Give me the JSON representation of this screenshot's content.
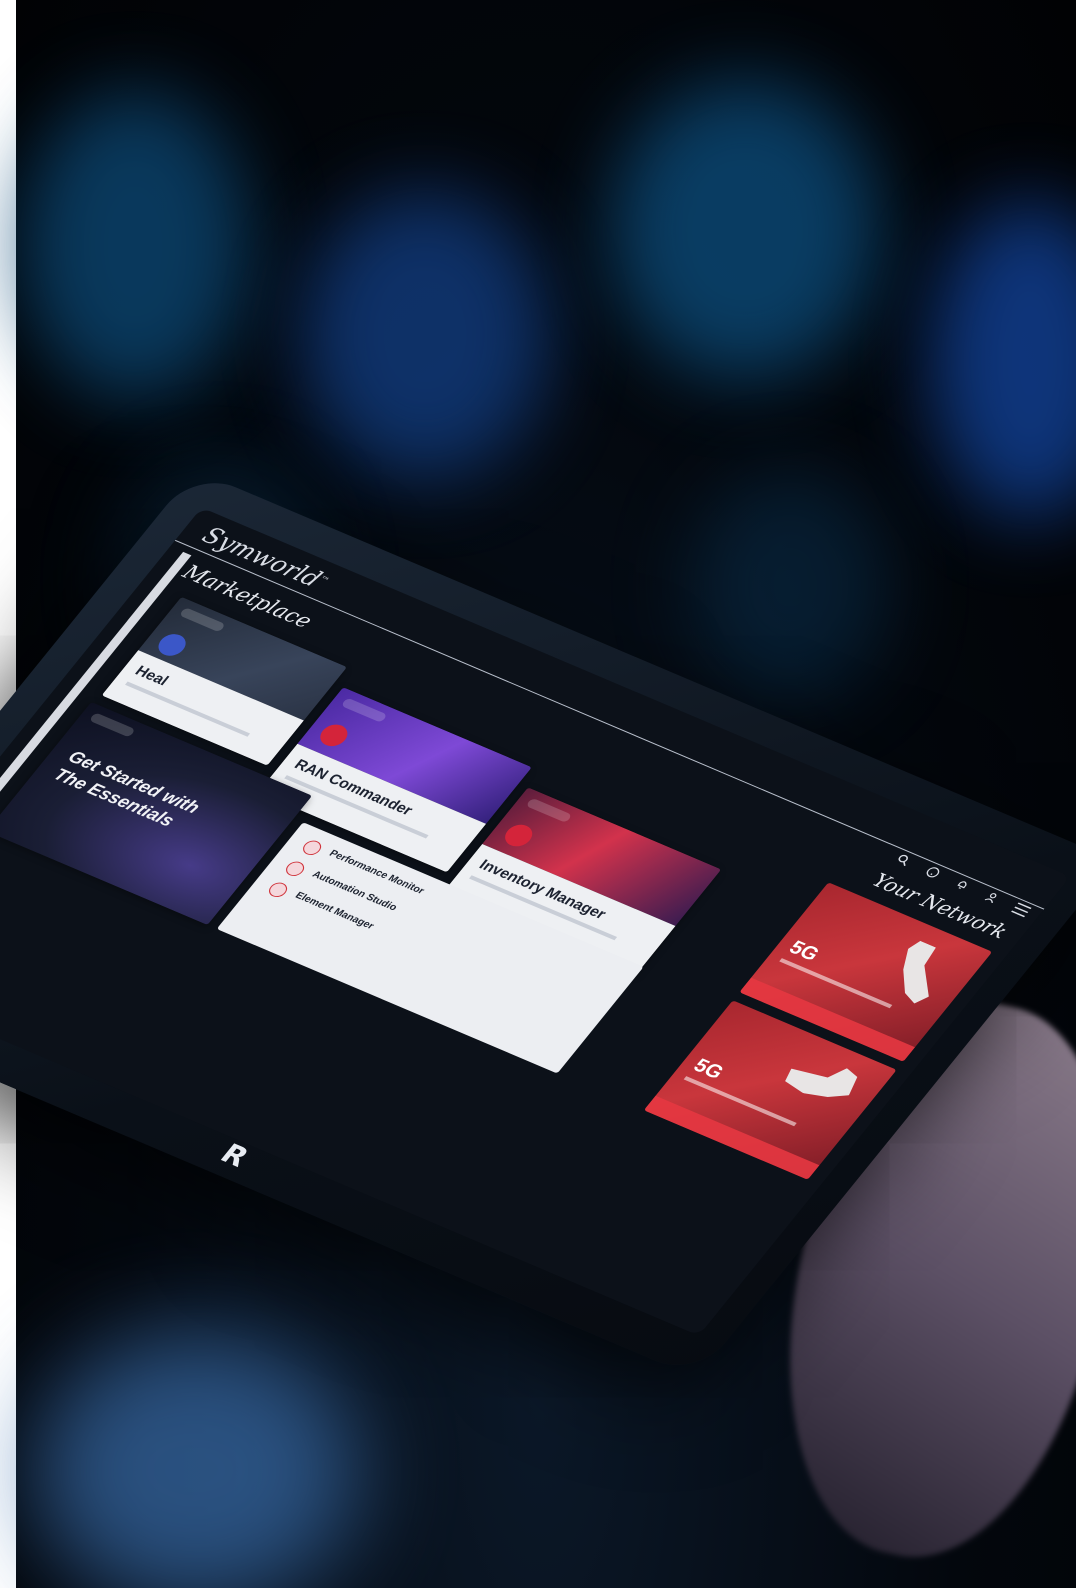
{
  "app": {
    "brand": "Symworld",
    "brand_mark": "™",
    "device_logo": "R"
  },
  "marketplace": {
    "title": "Marketplace",
    "cards": [
      {
        "title": "Heal"
      },
      {
        "title": "RAN Commander"
      },
      {
        "title": "Inventory Manager"
      }
    ],
    "essentials": {
      "title_line1": "Get Started with",
      "title_line2": "The Essentials"
    },
    "list_items": [
      {
        "name": "Performance Monitor"
      },
      {
        "name": "Automation Studio"
      },
      {
        "name": "Element Manager"
      }
    ]
  },
  "network": {
    "title": "Your Network",
    "cards": [
      {
        "label": "5G"
      },
      {
        "label": "5G"
      }
    ]
  },
  "colors": {
    "accent_red": "#c9363c",
    "accent_purple": "#7e49d6",
    "background": "#02050b"
  },
  "icons": [
    "search-icon",
    "help-icon",
    "notification-icon",
    "user-icon",
    "menu-icon"
  ]
}
